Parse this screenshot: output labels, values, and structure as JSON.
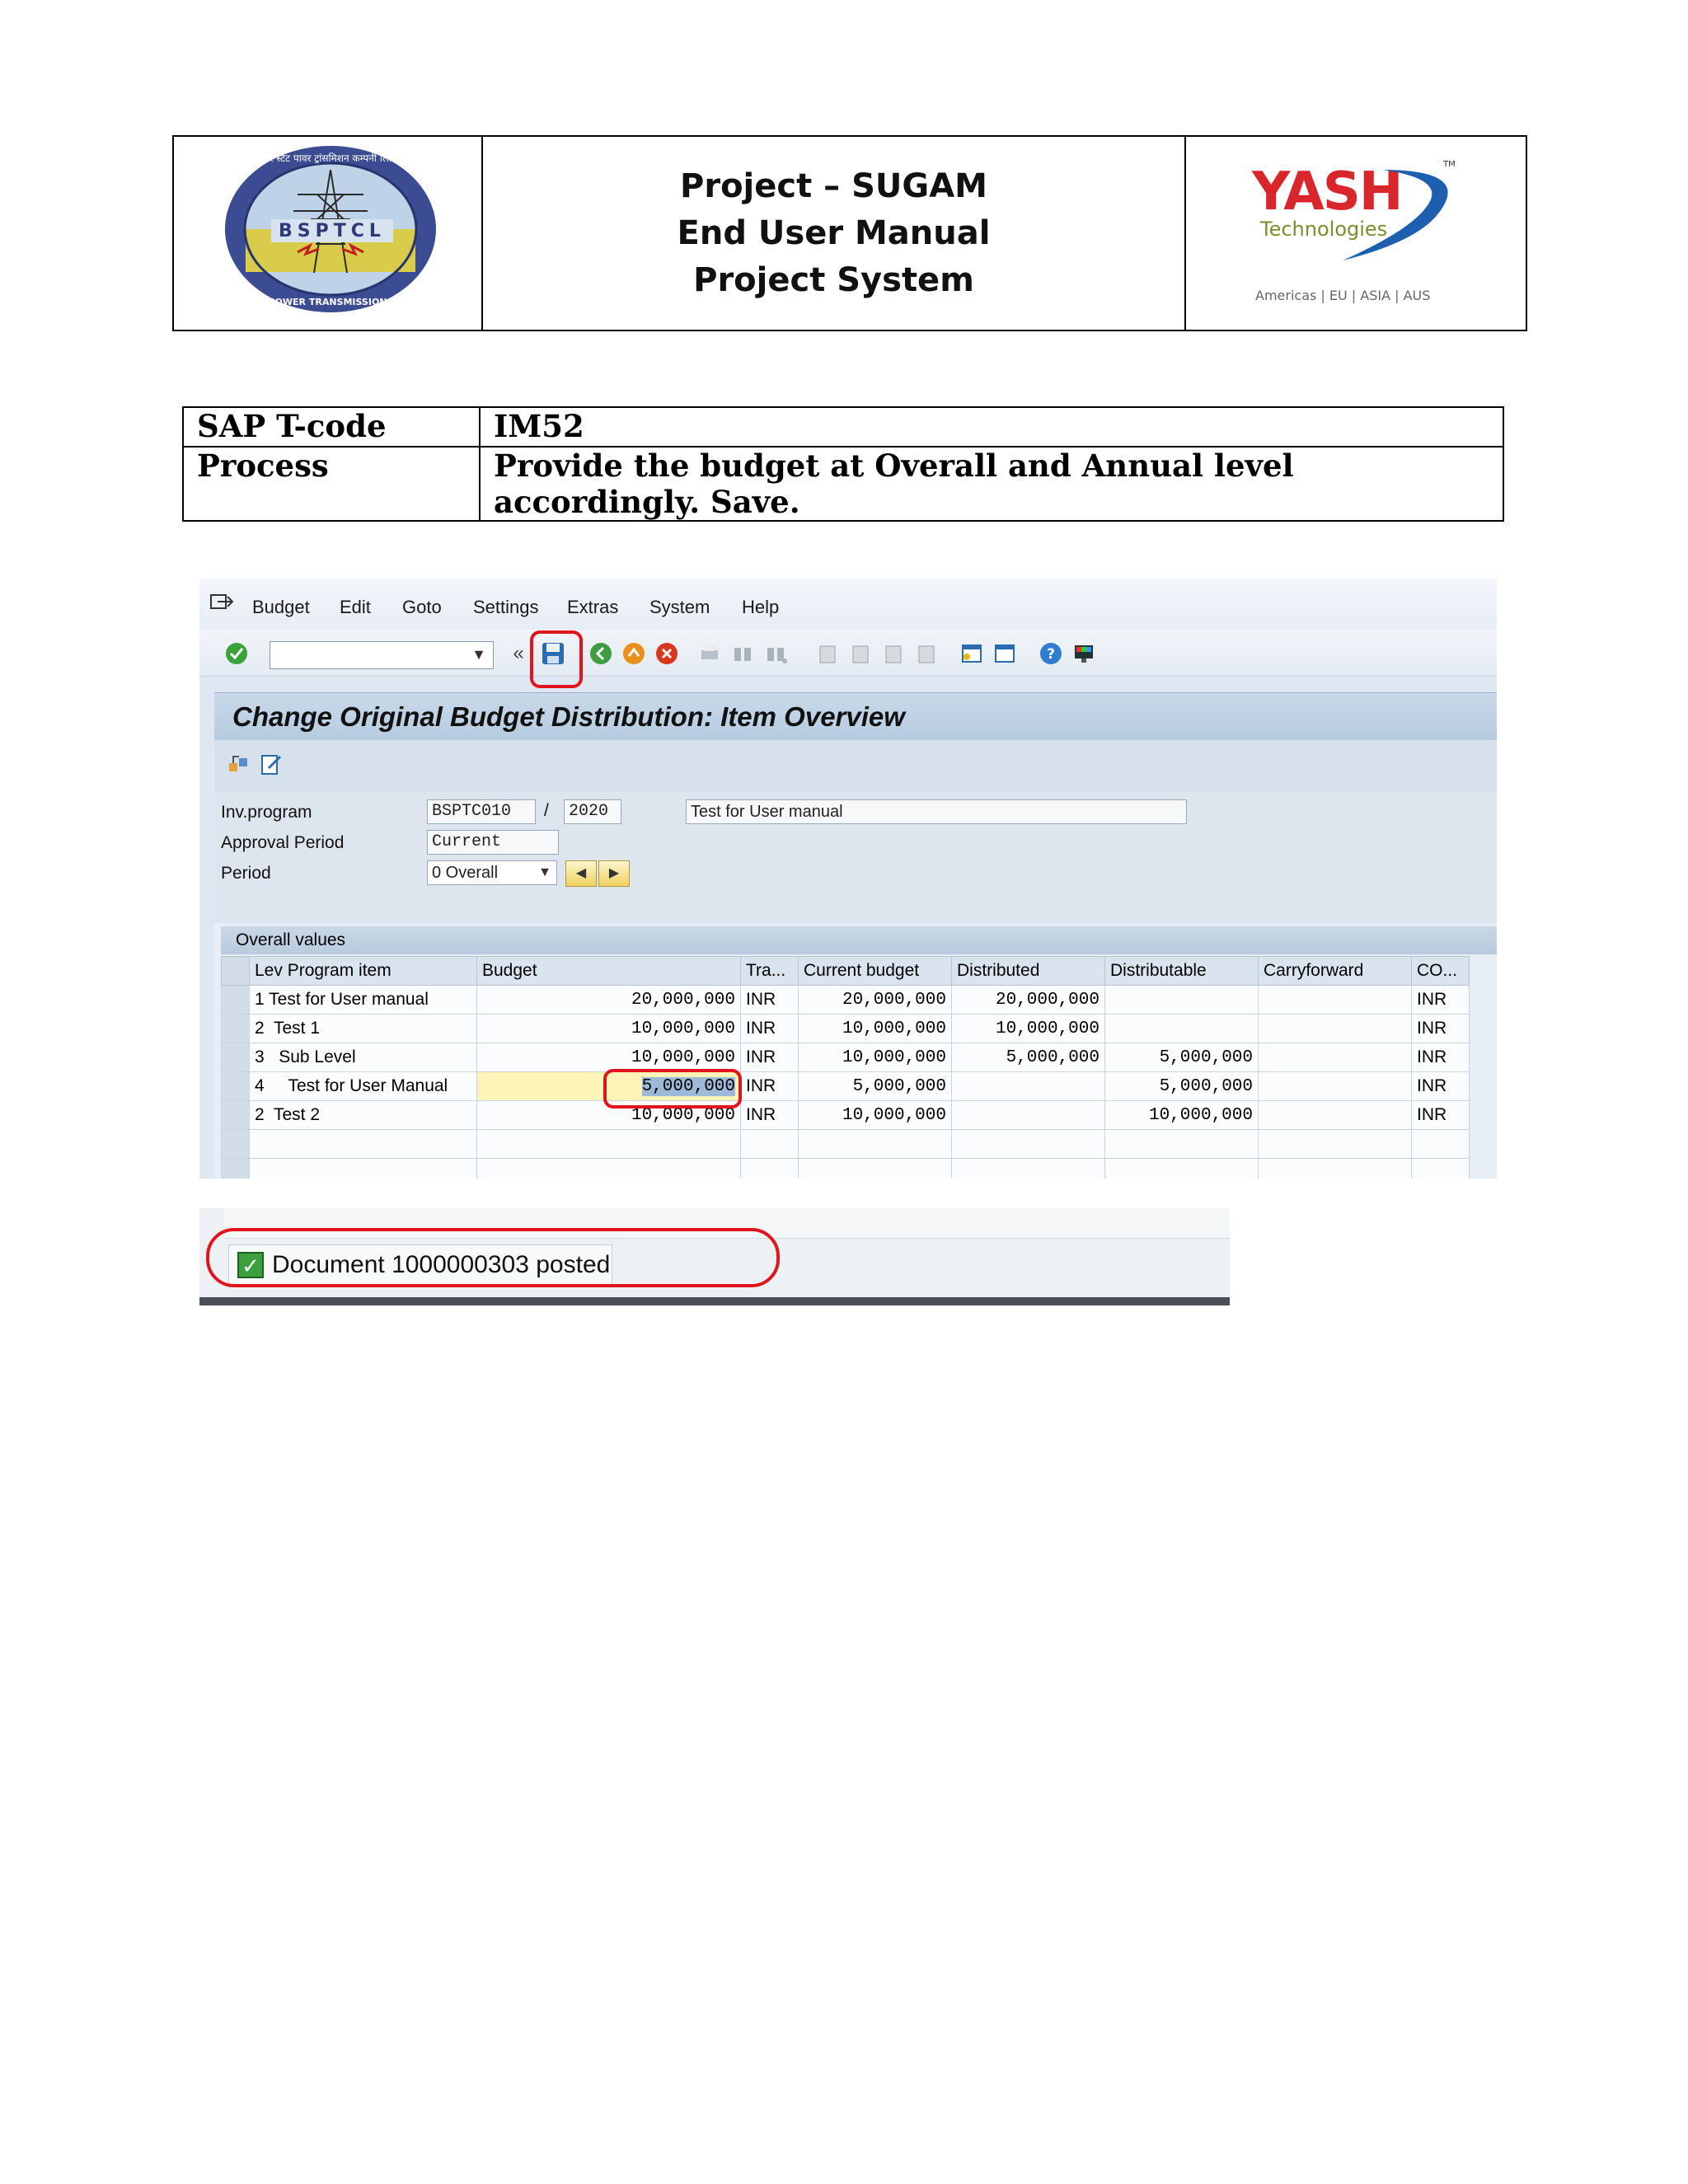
{
  "header": {
    "logo_left": {
      "org": "BSPTCL",
      "ring_text": "बिहार स्टेट पावर ट्रांसमिशन कम्पनी लिमिटेड"
    },
    "title_lines": [
      "Project – SUGAM",
      "End User Manual",
      "Project System"
    ],
    "logo_right": {
      "brand": "YASH",
      "sub": "Technologies",
      "tm": "TM",
      "regions": "Americas | EU | ASIA | AUS",
      "brand_color": "#d9262c",
      "swoosh_color": "#1d5fae"
    }
  },
  "tcode_table": {
    "rows": [
      {
        "key": "SAP T-code",
        "value": "IM52"
      },
      {
        "key": "Process",
        "value": "Provide the budget at Overall and Annual level accordingly. Save."
      }
    ]
  },
  "sap": {
    "menu": [
      "Budget",
      "Edit",
      "Goto",
      "Settings",
      "Extras",
      "System",
      "Help"
    ],
    "toolbar_icons": [
      "enter-icon",
      "save-icon",
      "back-icon",
      "exit-icon",
      "cancel-icon",
      "print-icon",
      "find-icon",
      "find-next-icon",
      "first-page-icon",
      "prev-page-icon",
      "next-page-icon",
      "last-page-icon",
      "new-session-icon",
      "shortcut-icon",
      "help-icon",
      "customize-icon"
    ],
    "title": "Change Original Budget Distribution: Item Overview",
    "fields": {
      "inv_program_label": "Inv.program",
      "inv_program_value": "BSPTC010",
      "separator": "/",
      "year": "2020",
      "description": "Test for User manual",
      "approval_period_label": "Approval Period",
      "approval_period_value": "Current",
      "period_label": "Period",
      "period_value": "0 Overall"
    },
    "section_title": "Overall values",
    "columns": [
      "Lev Program item",
      "Budget",
      "Tra...",
      "Current budget",
      "Distributed",
      "Distributable",
      "Carryforward",
      "CO..."
    ],
    "rows": [
      {
        "lev": "1",
        "item": "Test for User manual",
        "budget": "20,000,000",
        "tra": "INR",
        "current": "20,000,000",
        "distributed": "20,000,000",
        "distributable": "",
        "carryforward": "",
        "co": "INR"
      },
      {
        "lev": "2",
        "item": "Test 1",
        "budget": "10,000,000",
        "tra": "INR",
        "current": "10,000,000",
        "distributed": "10,000,000",
        "distributable": "",
        "carryforward": "",
        "co": "INR"
      },
      {
        "lev": "3",
        "item": "Sub Level",
        "budget": "10,000,000",
        "tra": "INR",
        "current": "10,000,000",
        "distributed": "5,000,000",
        "distributable": "5,000,000",
        "carryforward": "",
        "co": "INR"
      },
      {
        "lev": "4",
        "item": "Test for User Manual",
        "budget": "5,000,000",
        "tra": "INR",
        "current": "5,000,000",
        "distributed": "",
        "distributable": "5,000,000",
        "carryforward": "",
        "co": "INR"
      },
      {
        "lev": "2",
        "item": "Test 2",
        "budget": "10,000,000",
        "tra": "INR",
        "current": "10,000,000",
        "distributed": "",
        "distributable": "10,000,000",
        "carryforward": "",
        "co": "INR"
      }
    ],
    "status_message": "Document 1000000303 posted",
    "highlight_color": "#e0151c"
  }
}
